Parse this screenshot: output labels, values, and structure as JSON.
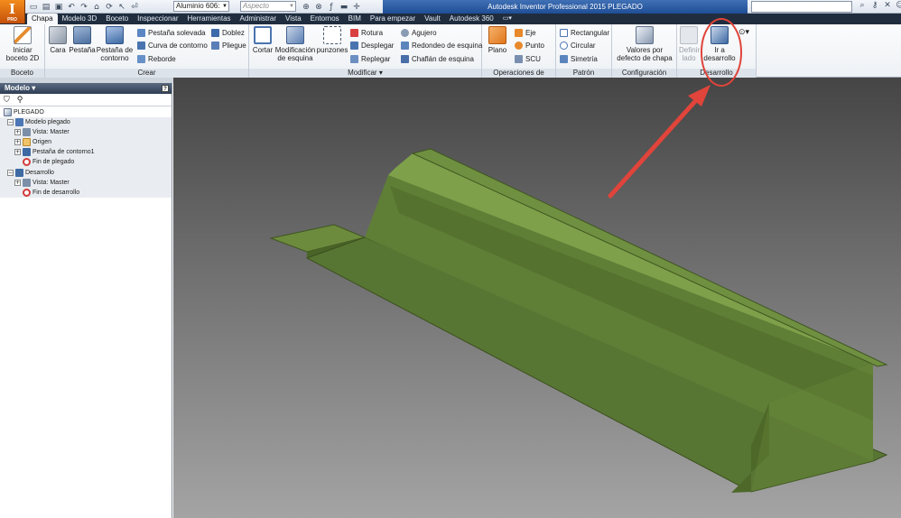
{
  "app": {
    "logo_letter": "I",
    "logo_sub": "PRO",
    "material": "Aluminio 606:",
    "appearance_placeholder": "Aspecto",
    "window_title": "Autodesk Inventor Professional 2015    PLEGADO"
  },
  "tabs": [
    "Chapa",
    "Modelo 3D",
    "Boceto",
    "Inspeccionar",
    "Herramientas",
    "Administrar",
    "Vista",
    "Entornos",
    "BIM",
    "Para empezar",
    "Vault",
    "Autodesk 360"
  ],
  "ribbon": {
    "boceto": {
      "label": "Boceto",
      "start_sketch": "Iniciar boceto 2D"
    },
    "crear": {
      "label": "Crear",
      "cara": "Cara",
      "pestana": "Pestaña",
      "pestana_contorno": "Pestaña de contorno",
      "pestana_solevada": "Pestaña solevada",
      "curva_contorno": "Curva de contorno",
      "reborde": "Reborde",
      "doblez": "Doblez",
      "pliegue": "Pliegue"
    },
    "modificar": {
      "label": "Modificar",
      "cortar": "Cortar",
      "mod_esquina": "Modificación de esquina",
      "punzones": "punzones",
      "rotura": "Rotura",
      "desplegar": "Desplegar",
      "replegar": "Replegar",
      "agujero": "Agujero",
      "redondeo": "Redondeo de esquina",
      "chaflan": "Chaflán de esquina"
    },
    "operaciones": {
      "label": "Operaciones de trabajo",
      "plano": "Plano",
      "eje": "Eje",
      "punto": "Punto",
      "scu": "SCU"
    },
    "patron": {
      "label": "Patrón",
      "rectangular": "Rectangular",
      "circular": "Circular",
      "simetria": "Simetría"
    },
    "configuracion": {
      "label": "Configuración",
      "valores": "Valores por defecto de chapa"
    },
    "desarrollo": {
      "label": "Desarrollo",
      "definir": "Definir lado",
      "ir": "Ir a desarrollo"
    }
  },
  "browser": {
    "title": "Modelo",
    "root": "PLEGADO",
    "nodes": [
      "Modelo plegado",
      "Vista: Master",
      "Origen",
      "Pestaña de contorno1",
      "Fin de plegado",
      "Desarrollo",
      "Vista: Master",
      "Fin de desarrollo"
    ]
  },
  "colors": {
    "part": "#5d7b34",
    "annotation": "#e0443a",
    "tabbar": "#1f2d3f"
  }
}
